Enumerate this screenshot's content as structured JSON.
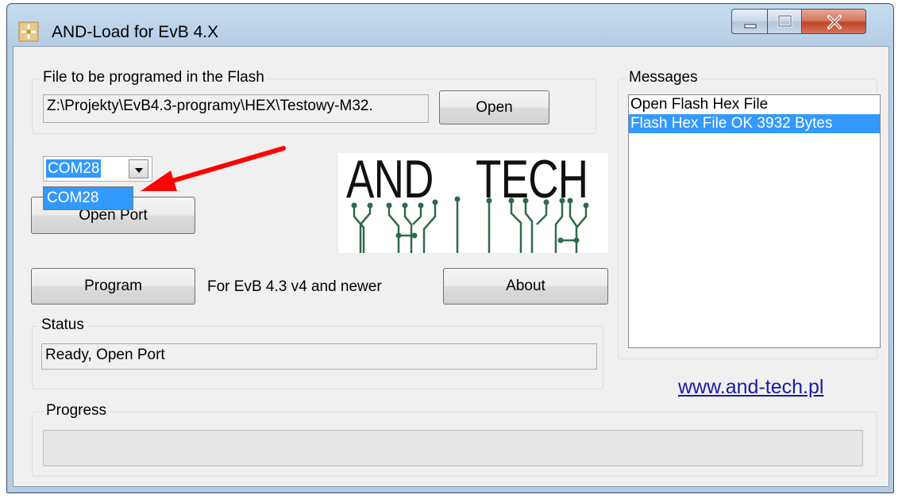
{
  "window": {
    "title": "AND-Load for EvB 4.X",
    "controls": {
      "minimize_icon": "minimize-icon",
      "maximize_icon": "maximize-icon",
      "close_icon": "close-icon"
    }
  },
  "file_group": {
    "label": "File to be programed in the Flash",
    "path_value": "Z:\\Projekty\\EvB4.3-programy\\HEX\\Testowy-M32.",
    "open_button": "Open"
  },
  "port": {
    "selected": "COM28",
    "dropdown_item": "COM28",
    "open_port_button": "Open Port"
  },
  "logo": {
    "text_left": "AND",
    "text_right": "TECH"
  },
  "actions": {
    "program_button": "Program",
    "version_note": "For EvB 4.3 v4 and newer",
    "about_button": "About"
  },
  "status": {
    "label": "Status",
    "value": "Ready, Open Port"
  },
  "messages": {
    "label": "Messages",
    "items": [
      "Open Flash Hex File",
      "Flash Hex File OK 3932 Bytes"
    ],
    "selected_index": 1
  },
  "website": {
    "link": "www.and-tech.pl"
  },
  "progress": {
    "label": "Progress",
    "value": 0
  },
  "colors": {
    "selection": "#3399ff",
    "link": "#1a1aa6",
    "logo_green": "#2e6b48",
    "annotation_arrow": "#ff0000"
  }
}
